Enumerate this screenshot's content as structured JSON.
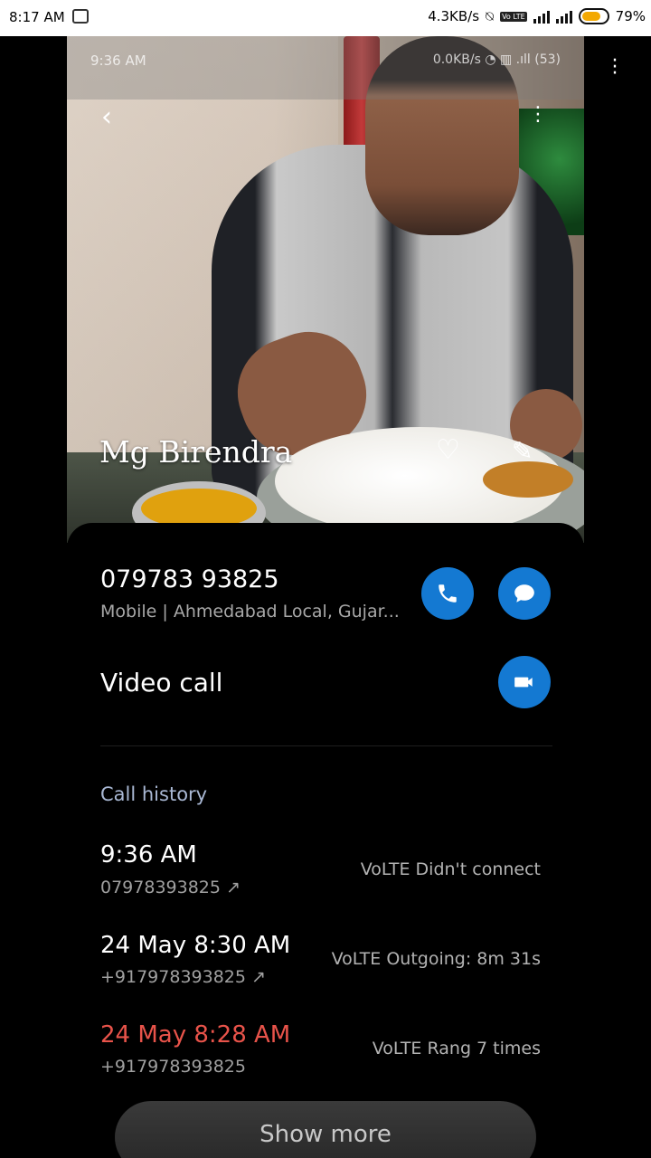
{
  "status_bar": {
    "time": "8:17 AM",
    "net_speed": "4.3KB/s",
    "volte_chip": "Vo LTE",
    "battery": "79%",
    "battery_color": "#f3a800"
  },
  "photo_overlay": {
    "time": "9:36 AM",
    "net_speed": "0.0KB/s",
    "battery": "53",
    "back_icon": "chevron-left-icon",
    "more_icon": "more-vertical-icon"
  },
  "contact": {
    "name": "Mg Birendra",
    "fav_icon": "heart-outline-icon",
    "edit_icon": "edit-icon"
  },
  "phone": {
    "number": "079783 93825",
    "type": "Mobile",
    "separator": "|",
    "location": "Ahmedabad Local, Gujar...",
    "call_icon": "phone-icon",
    "message_icon": "message-icon",
    "accent": "#1479d2"
  },
  "video": {
    "label": "Video call",
    "icon": "video-camera-icon"
  },
  "call_history": {
    "title": "Call history",
    "items": [
      {
        "time": "9:36 AM",
        "number": "07978393825 ↗",
        "status": "VoLTE  Didn't connect",
        "missed": false
      },
      {
        "time": "24 May 8:30 AM",
        "number": "+917978393825 ↗",
        "status": "VoLTE  Outgoing: 8m 31s",
        "missed": false
      },
      {
        "time": "24 May 8:28 AM",
        "number": "+917978393825",
        "status": "VoLTE  Rang 7 times",
        "missed": true
      }
    ],
    "missed_color": "#e8534a"
  },
  "show_more": "Show more"
}
